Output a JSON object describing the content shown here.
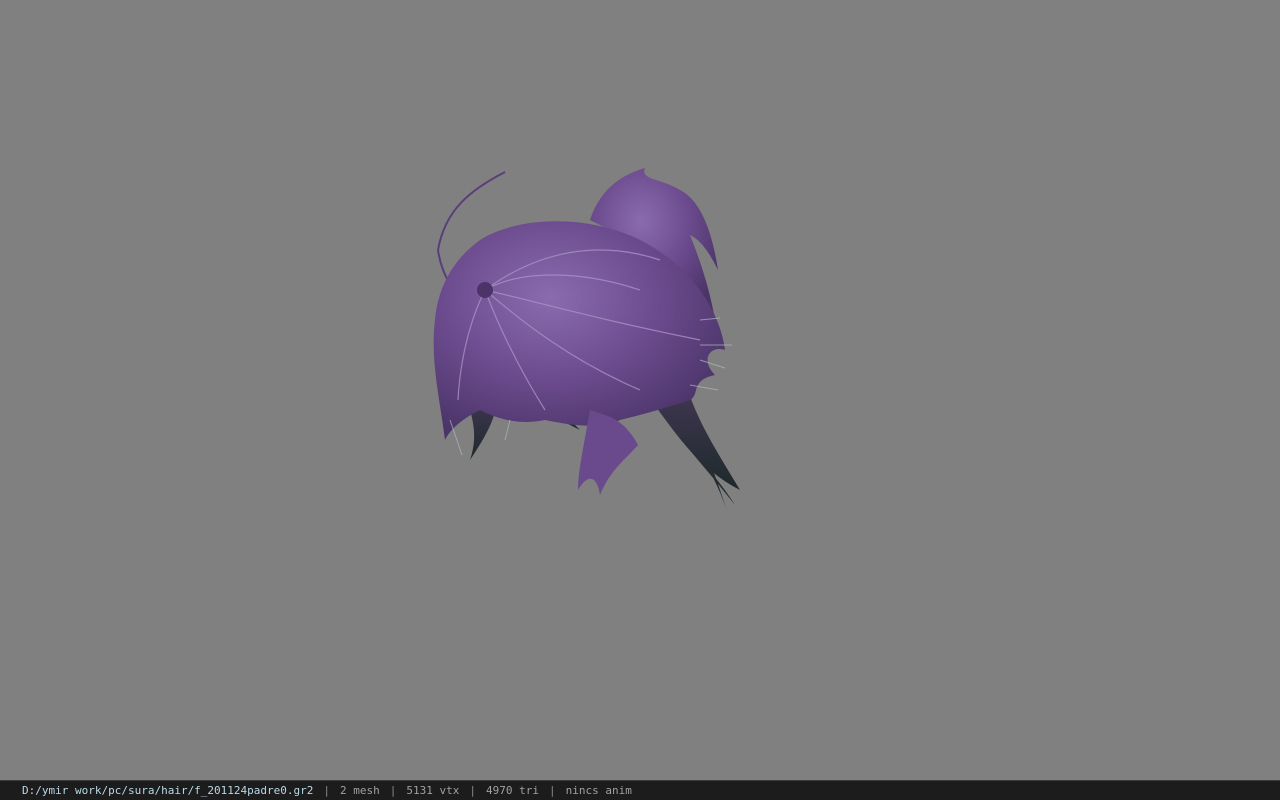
{
  "viewport": {
    "background_color": "#808080",
    "model": {
      "hair_color": "#6a4a8c",
      "hair_highlight_color": "#9a82bc",
      "hair_shadow_color": "#2c2c3a"
    }
  },
  "status_bar": {
    "file_path": "D:/ymir work/pc/sura/hair/f_201124padre0.gr2",
    "mesh": "2 mesh",
    "vertices": "5131 vtx",
    "triangles": "4970 tri",
    "anim": "nincs anim",
    "separator": "|"
  }
}
